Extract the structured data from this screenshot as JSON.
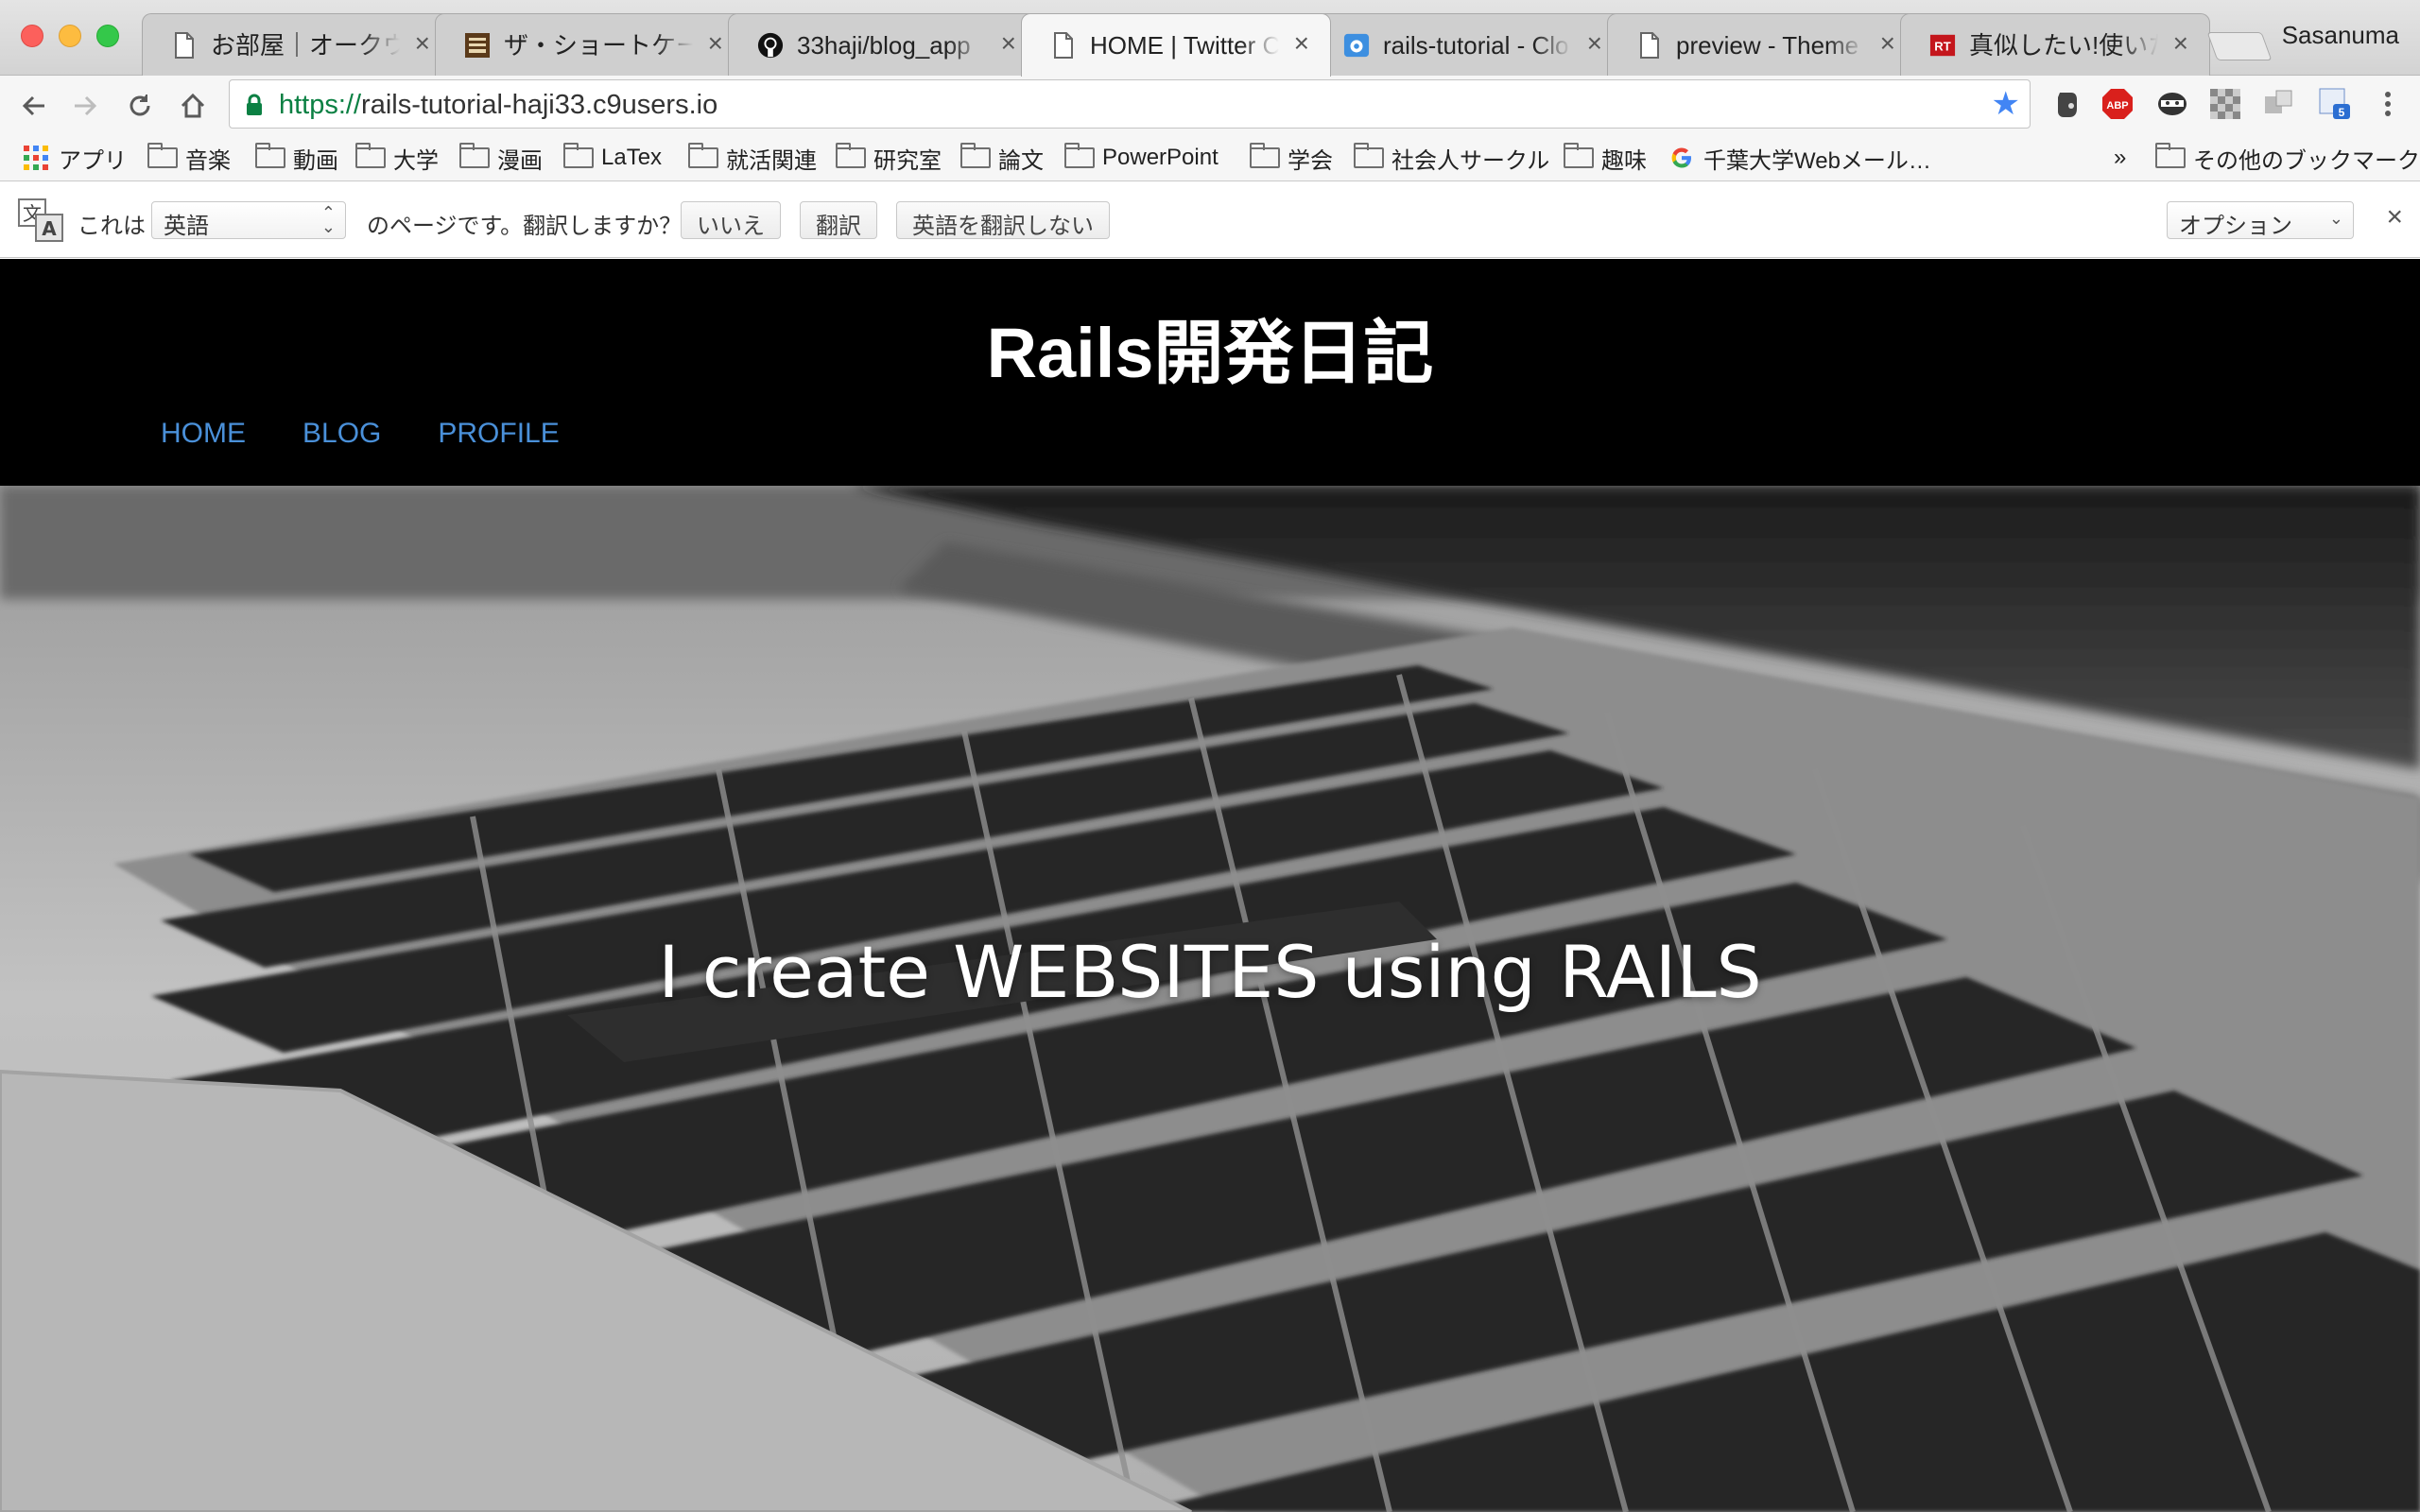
{
  "window": {
    "profile_name": "Sasanuma"
  },
  "tabs": [
    {
      "title": "お部屋｜オークウッ",
      "icon": "page-icon",
      "active": false
    },
    {
      "title": "ザ・ショートケーキ",
      "icon": "site-favicon",
      "active": false
    },
    {
      "title": "33haji/blog_app",
      "icon": "github-icon",
      "active": false
    },
    {
      "title": "HOME | Twitter C",
      "icon": "page-icon",
      "active": true
    },
    {
      "title": "rails-tutorial - Clo",
      "icon": "cloud9-icon",
      "active": false
    },
    {
      "title": "preview - Theme",
      "icon": "page-icon",
      "active": false
    },
    {
      "title": "真似したい!使いたい",
      "icon": "rt-icon",
      "active": false
    }
  ],
  "toolbar": {
    "url_scheme": "https://",
    "url_host": "rails-tutorial-haji33.c9users.io"
  },
  "bookmarks": {
    "apps_label": "アプリ",
    "items": [
      "音楽",
      "動画",
      "大学",
      "漫画",
      "LaTex",
      "就活関連",
      "研究室",
      "論文",
      "PowerPoint",
      "学会",
      "社会人サークル",
      "趣味"
    ],
    "google_item": "千葉大学Webメール…",
    "overflow": "»",
    "other": "その他のブックマーク"
  },
  "translate": {
    "prefix": "これは",
    "language": "英語",
    "suffix": "のページです。翻訳しますか？",
    "no_button": "いいえ",
    "translate_button": "翻訳",
    "never_button": "英語を翻訳しない",
    "options": "オプション",
    "close": "×"
  },
  "site": {
    "title": "Rails開発日記",
    "nav": [
      "HOME",
      "BLOG",
      "PROFILE"
    ],
    "hero_text": "I create WEBSITES using RAILS"
  },
  "colors": {
    "nav_link": "#4a90d9",
    "header_bg": "#000000",
    "url_scheme": "#0b8043",
    "bookmark_star": "#4285f4"
  }
}
